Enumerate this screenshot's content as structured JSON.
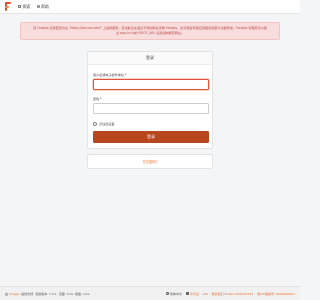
{
  "nav": {
    "explore": "探索",
    "help": "帮助"
  },
  "alert": {
    "text": "您 Forgejo 实例配置为在 \"https://secure.com/\" 上提供服务。您当前正在通过不同的网址查看 Forgejo。这可能会导致应用程序的部分功能异常。Forgejo 管理员可以通过 app.ini 中的 ROOT_URL 设置控制规范网址。"
  },
  "login": {
    "title": "登录",
    "username_label": "用户名或电子邮件地址 *",
    "username_value": "",
    "password_label": "密码 *",
    "password_value": "",
    "remember_label": "记住此设备",
    "submit_label": "登录",
    "forgot_label": "忘记密码?"
  },
  "footer": {
    "powered_prefix": "由",
    "powered_link": "Forgejo",
    "powered_suffix": "提供支持",
    "version": "当前版本: 7.0.1",
    "page_time": "页面: 1ms",
    "template_time": "模板: 1ms",
    "language": "简体中文",
    "api_label": "API",
    "contact": "联系我们:Email 2424071743",
    "license_label": "许可证",
    "icp": "鲁ICP备案号: 0014620001"
  },
  "colors": {
    "accent": "#b8461f",
    "link": "#e06a2c",
    "alert_bg": "#f9dcdc",
    "alert_text": "#b74848"
  }
}
